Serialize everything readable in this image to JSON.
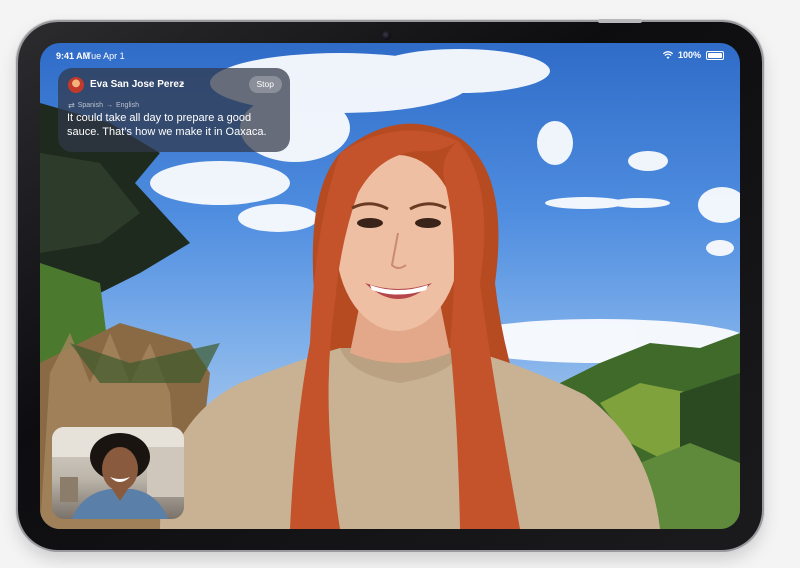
{
  "status_bar": {
    "time": "9:41 AM",
    "date": "Tue Apr 1",
    "battery": "100%",
    "wifi_icon": "wifi-icon",
    "battery_icon": "battery-icon"
  },
  "caption": {
    "caller_name": "Eva San Jose Perez",
    "chevron": "›",
    "stop_label": "Stop",
    "source_language": "Spanish",
    "arrow": "→",
    "target_language": "English",
    "translated_text": "It could take all day to prepare a good sauce. That’s how we make it in Oaxaca."
  },
  "colors": {
    "device_frame": "#1c1c1e",
    "sky": "#4f8de0",
    "hair": "#c4522a",
    "sweater": "#cdb79a",
    "caption_bg": "#303848"
  }
}
